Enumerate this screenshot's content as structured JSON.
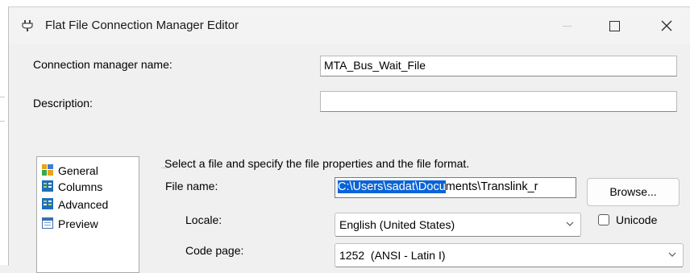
{
  "window": {
    "title": "Flat File Connection Manager Editor"
  },
  "form": {
    "name_label": "Connection manager name:",
    "name_value": "MTA_Bus_Wait_File",
    "description_label": "Description:",
    "description_value": ""
  },
  "nav": {
    "items": [
      {
        "label": "General",
        "icon": "general-icon"
      },
      {
        "label": "Columns",
        "icon": "columns-icon"
      },
      {
        "label": "Advanced",
        "icon": "advanced-icon"
      },
      {
        "label": "Preview",
        "icon": "preview-icon"
      }
    ]
  },
  "general": {
    "group_caption": "Select a file and specify the file properties and the file format.",
    "file_name_label": "File name:",
    "file_name_selected": "C:\\Users\\sadat\\Docu",
    "file_name_rest": "ments\\Translink_r",
    "browse_label": "Browse...",
    "locale_label": "Locale:",
    "locale_value": "English (United States)",
    "unicode_label": "Unicode",
    "unicode_checked": false,
    "codepage_label": "Code page:",
    "codepage_value": "1252  (ANSI - Latin I)"
  },
  "colors": {
    "selection": "#0a64d7",
    "window_bg": "#f0f0f0"
  }
}
